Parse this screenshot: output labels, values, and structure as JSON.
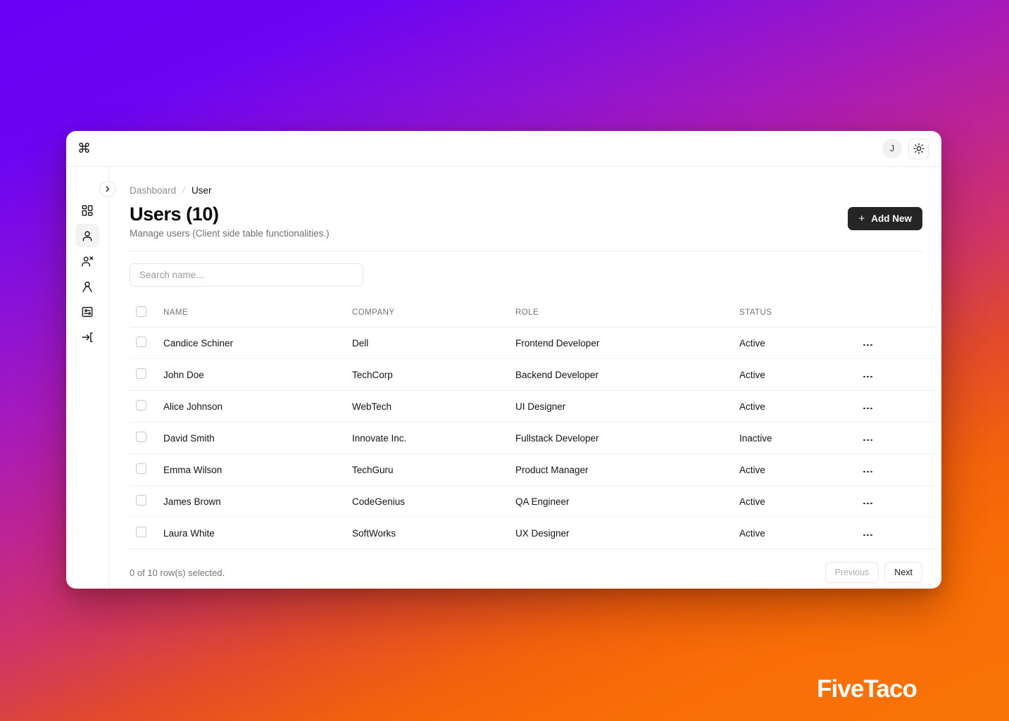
{
  "background": {
    "gradient_from": "#6a00f4",
    "gradient_mid": "#c0258f",
    "gradient_to": "#f97306"
  },
  "watermark": {
    "text": "FiveTaco"
  },
  "topbar": {
    "logo_glyph": "⌘",
    "avatar_initial": "J",
    "theme_toggle_icon": "sun-icon"
  },
  "sidebar": {
    "collapse_icon": "chevron-right-icon",
    "items": [
      {
        "icon": "dashboard-grid-icon",
        "name": "dashboard",
        "active": false
      },
      {
        "icon": "user-icon",
        "name": "users",
        "active": true
      },
      {
        "icon": "user-x-icon",
        "name": "blocked-users",
        "active": false
      },
      {
        "icon": "user-outline-icon",
        "name": "profile",
        "active": false
      },
      {
        "icon": "id-card-icon",
        "name": "account",
        "active": false
      },
      {
        "icon": "login-arrow-icon",
        "name": "sign-in",
        "active": false
      }
    ]
  },
  "breadcrumb": {
    "root": "Dashboard",
    "separator": "/",
    "current": "User"
  },
  "header": {
    "title": "Users (10)",
    "subtitle": "Manage users (Client side table functionalities.)",
    "add_button": {
      "label": "Add New",
      "plus": "+"
    }
  },
  "search": {
    "value": "",
    "placeholder": "Search name..."
  },
  "table": {
    "columns": [
      "NAME",
      "COMPANY",
      "ROLE",
      "STATUS"
    ],
    "rows": [
      {
        "name": "Candice Schiner",
        "company": "Dell",
        "role": "Frontend Developer",
        "status": "Active"
      },
      {
        "name": "John Doe",
        "company": "TechCorp",
        "role": "Backend Developer",
        "status": "Active"
      },
      {
        "name": "Alice Johnson",
        "company": "WebTech",
        "role": "UI Designer",
        "status": "Active"
      },
      {
        "name": "David Smith",
        "company": "Innovate Inc.",
        "role": "Fullstack Developer",
        "status": "Inactive"
      },
      {
        "name": "Emma Wilson",
        "company": "TechGuru",
        "role": "Product Manager",
        "status": "Active"
      },
      {
        "name": "James Brown",
        "company": "CodeGenius",
        "role": "QA Engineer",
        "status": "Active"
      },
      {
        "name": "Laura White",
        "company": "SoftWorks",
        "role": "UX Designer",
        "status": "Active"
      }
    ]
  },
  "footer": {
    "rows_selected": "0 of 10 row(s) selected.",
    "previous_label": "Previous",
    "next_label": "Next"
  }
}
